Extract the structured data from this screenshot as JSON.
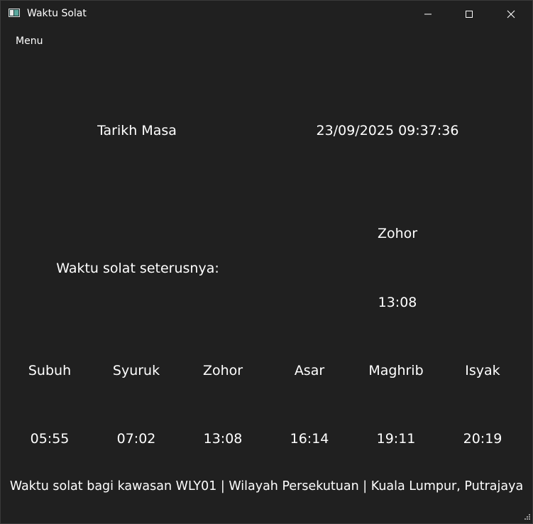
{
  "window": {
    "title": "Waktu Solat"
  },
  "menu": {
    "label": "Menu"
  },
  "datetime": {
    "label": "Tarikh Masa",
    "value": "23/09/2025 09:37:36"
  },
  "next_prayer": {
    "label": "Waktu solat seterusnya:",
    "name": "Zohor",
    "time": "13:08"
  },
  "prayers": [
    {
      "name": "Subuh",
      "time": "05:55"
    },
    {
      "name": "Syuruk",
      "time": "07:02"
    },
    {
      "name": "Zohor",
      "time": "13:08"
    },
    {
      "name": "Asar",
      "time": "16:14"
    },
    {
      "name": "Maghrib",
      "time": "19:11"
    },
    {
      "name": "Isyak",
      "time": "20:19"
    }
  ],
  "footer": {
    "text": "Waktu solat bagi kawasan WLY01 | Wilayah Persekutuan | Kuala Lumpur, Putrajaya"
  },
  "icons": {
    "app": "app-window-icon",
    "minimize": "minimize-icon",
    "maximize": "maximize-icon",
    "close": "close-icon",
    "resize": "resize-grip-icon"
  },
  "colors": {
    "background": "#202020",
    "text": "#ffffff"
  }
}
